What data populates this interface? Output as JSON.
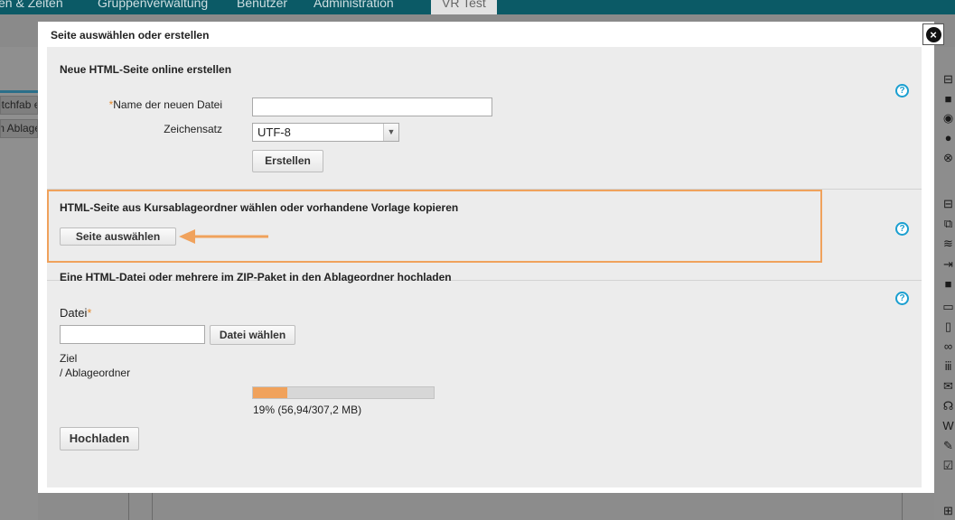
{
  "background": {
    "top_nav": [
      "en & Zeiten",
      "Gruppenverwaltung",
      "Benutzer",
      "Administration",
      "VR Test"
    ],
    "left_items": [
      "etchfab ein",
      "m Ablage"
    ]
  },
  "modal": {
    "title": "Seite auswählen oder erstellen",
    "close_icon": "×",
    "help_icon": "?",
    "new_page": {
      "title": "Neue HTML-Seite online erstellen",
      "name_label": "Name der neuen Datei",
      "name_value": "",
      "charset_label": "Zeichensatz",
      "charset_value": "UTF-8",
      "create_button": "Erstellen"
    },
    "choose_page": {
      "title": "HTML-Seite aus Kursablageordner wählen oder vorhandene Vorlage kopieren",
      "select_button": "Seite auswählen"
    },
    "upload": {
      "title": "Eine HTML-Datei oder mehrere im ZIP-Paket in den Ablageordner hochladen",
      "file_label": "Datei",
      "file_value": "",
      "choose_file_button": "Datei wählen",
      "target_label": "Ziel",
      "target_value": "/ Ablageordner",
      "progress_fraction": 0.19,
      "progress_text": "19% (56,94/307,2 MB)",
      "upload_button": "Hochladen"
    }
  },
  "colors": {
    "accent_orange": "#f0a25c",
    "help_blue": "#1a9fd0",
    "nav_teal": "#0b5a66"
  }
}
